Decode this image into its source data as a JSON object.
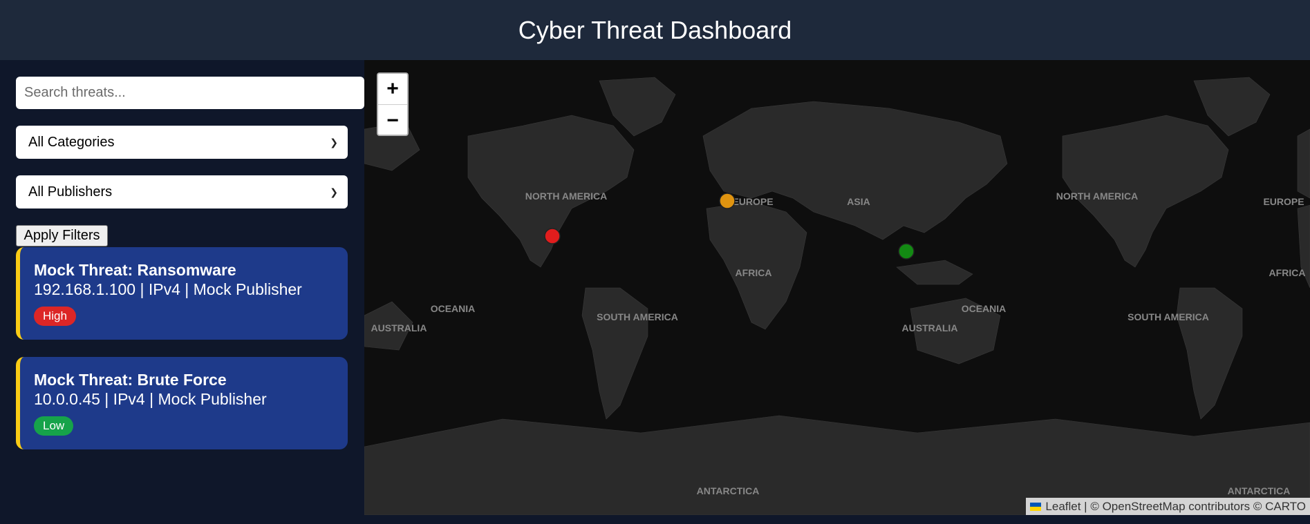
{
  "header": {
    "title": "Cyber Threat Dashboard"
  },
  "filters": {
    "search_placeholder": "Search threats...",
    "category_selected": "All Categories",
    "publisher_selected": "All Publishers",
    "apply_label": "Apply Filters"
  },
  "threats": [
    {
      "title": "Mock Threat: Ransomware",
      "meta": "192.168.1.100 | IPv4 | Mock Publisher",
      "severity": "High",
      "severity_color": "#dc2626"
    },
    {
      "title": "Mock Threat: Brute Force",
      "meta": "10.0.0.45 | IPv4 | Mock Publisher",
      "severity": "Low",
      "severity_color": "#16a34a"
    }
  ],
  "map": {
    "zoom_in": "+",
    "zoom_out": "−",
    "attribution": "Leaflet | © OpenStreetMap contributors © CARTO",
    "labels": [
      "NORTH AMERICA",
      "EUROPE",
      "ASIA",
      "AFRICA",
      "OCEANIA",
      "AUSTRALIA",
      "SOUTH AMERICA",
      "ANTARCTICA"
    ],
    "markers": [
      {
        "severity": "High",
        "color": "#e11d1d"
      },
      {
        "severity": "Medium",
        "color": "#e09410"
      },
      {
        "severity": "Low",
        "color": "#138a13"
      }
    ]
  },
  "colors": {
    "accent": "#facc15",
    "card": "#1e3a8a",
    "header": "#1e293b",
    "sidebar": "#0f172a"
  }
}
